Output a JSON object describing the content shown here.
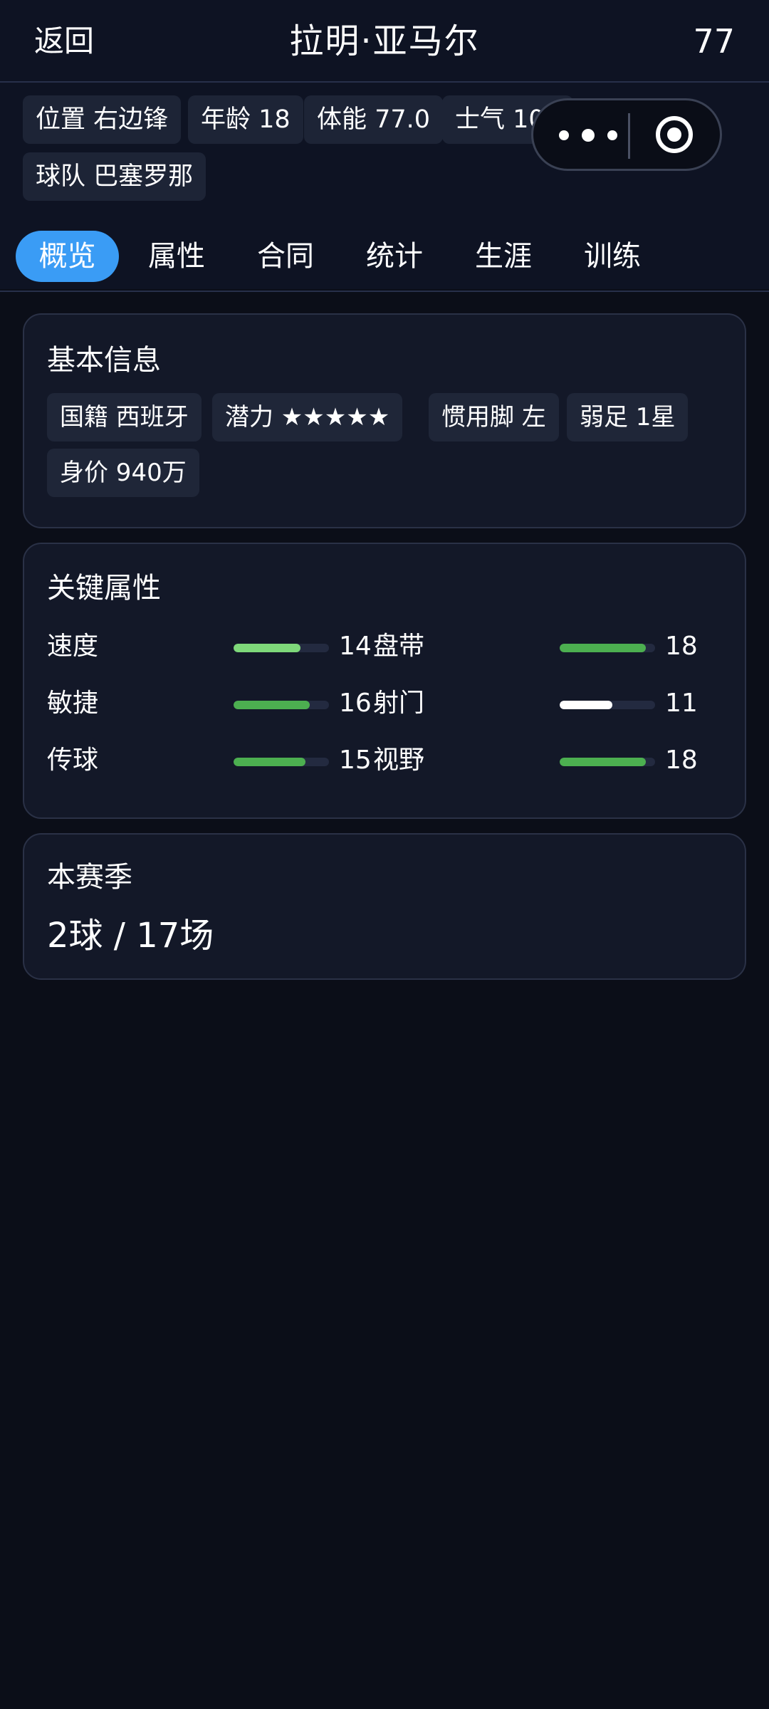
{
  "header": {
    "back_label": "返回",
    "title": "拉明·亚马尔",
    "rating": "77"
  },
  "chips": [
    {
      "label": "位置 右边锋"
    },
    {
      "label": "年龄 18"
    },
    {
      "label": "体能 77.0"
    },
    {
      "label": "士气 100"
    },
    {
      "label": "球队 巴塞罗那"
    }
  ],
  "capsule": {
    "menu_icon": "more-dots-icon",
    "close_icon": "target-circle-icon"
  },
  "tabs": [
    {
      "label": "概览",
      "active": true
    },
    {
      "label": "属性",
      "active": false
    },
    {
      "label": "合同",
      "active": false
    },
    {
      "label": "统计",
      "active": false
    },
    {
      "label": "生涯",
      "active": false
    },
    {
      "label": "训练",
      "active": false
    }
  ],
  "basic_info": {
    "title": "基本信息",
    "tags": [
      {
        "label": "国籍 西班牙"
      },
      {
        "label": "潜力 ★★★★★"
      },
      {
        "label": "惯用脚 左"
      },
      {
        "label": "弱足 1星"
      },
      {
        "label": "身价 940万"
      }
    ]
  },
  "key_attributes": {
    "title": "关键属性",
    "max_value": 20,
    "rows": [
      [
        {
          "label": "速度",
          "value": "14",
          "fill": 0.7,
          "color": "#7ed87a"
        },
        {
          "label": "盘带",
          "value": "18",
          "fill": 0.9,
          "color": "#4caf50"
        }
      ],
      [
        {
          "label": "敏捷",
          "value": "16",
          "fill": 0.8,
          "color": "#4caf50"
        },
        {
          "label": "射门",
          "value": "11",
          "fill": 0.55,
          "color": "#ffffff"
        }
      ],
      [
        {
          "label": "传球",
          "value": "15",
          "fill": 0.75,
          "color": "#4caf50"
        },
        {
          "label": "视野",
          "value": "18",
          "fill": 0.9,
          "color": "#4caf50"
        }
      ]
    ]
  },
  "season": {
    "title": "本赛季",
    "summary": "2球 / 17场"
  },
  "colors": {
    "accent": "#3a9cf5",
    "background": "#0b0e18",
    "card": "#131828"
  }
}
